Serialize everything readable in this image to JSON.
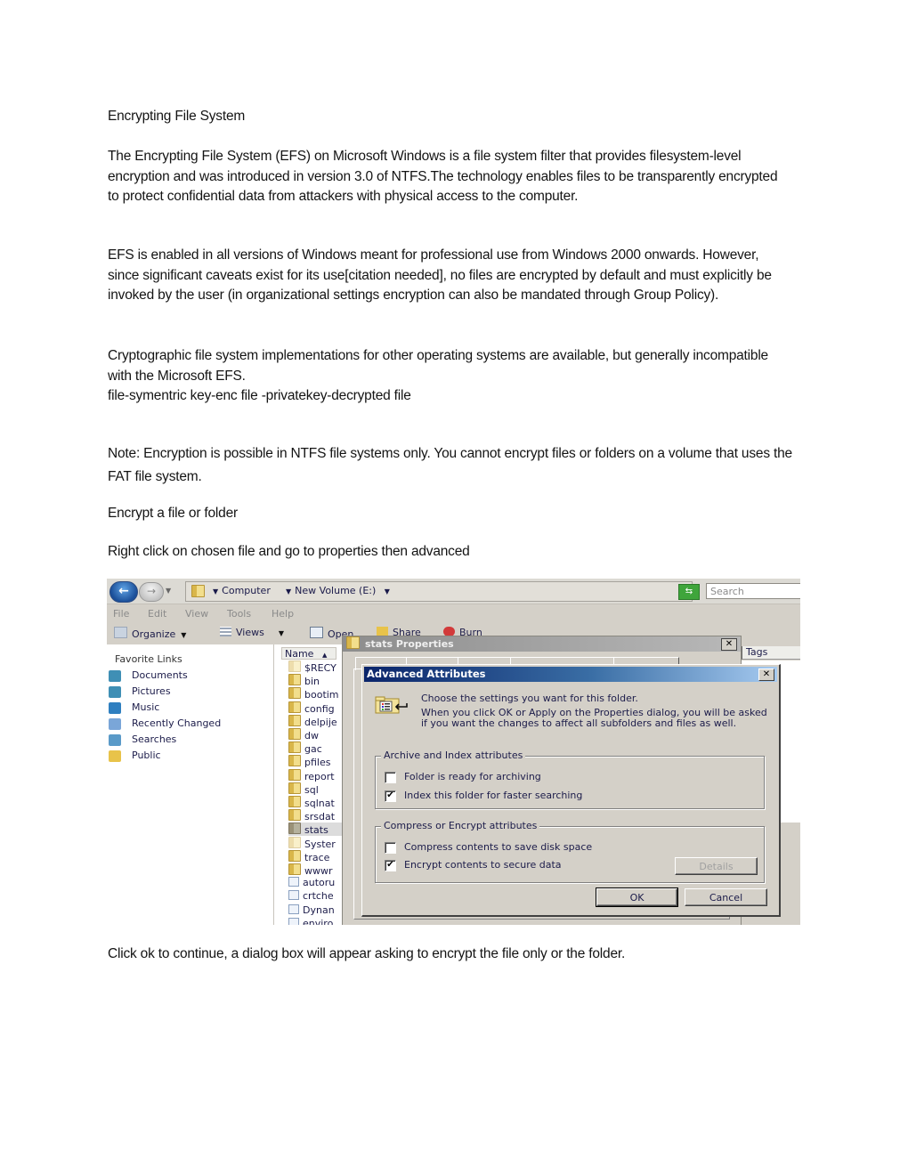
{
  "document": {
    "title": "Encrypting File System",
    "paragraphs": {
      "intro": "The Encrypting File System (EFS) on Microsoft Windows is a file system filter that provides filesystem-level encryption and was introduced in version 3.0 of NTFS.The technology enables files to be transparently encrypted to protect confidential data from attackers with physical access to the computer.",
      "enabled": "EFS is enabled in all versions of Windows meant for professional use from Windows 2000 onwards. However, since significant caveats exist for its use[citation needed], no files are encrypted by default and must explicitly be invoked by the user (in organizational settings encryption can also be mandated through Group Policy).",
      "crypto": "Cryptographic file system implementations for other operating systems are available, but generally incompatible with the Microsoft EFS.",
      "flow": "file-symentric key-enc file -privatekey-decrypted file",
      "note": "Note: Encryption is possible in NTFS file systems only. You cannot encrypt files or folders on a volume that uses the FAT file system.",
      "heading2": "Encrypt a file or folder",
      "step1": "Right click on chosen file and go to properties then advanced",
      "step2": "Click ok to continue, a dialog box will appear asking  to encrypt the file only or the folder."
    }
  },
  "screenshot": {
    "address_bar": {
      "breadcrumbs": [
        "Computer",
        "New Volume (E:)"
      ],
      "search_placeholder": "Search",
      "back_icon": "back-arrow-icon",
      "forward_icon": "forward-arrow-icon",
      "refresh_icon": "refresh-icon"
    },
    "menu": [
      "File",
      "Edit",
      "View",
      "Tools",
      "Help"
    ],
    "toolbar": {
      "organize": "Organize",
      "views": "Views",
      "open": "Open",
      "share": "Share",
      "burn": "Burn"
    },
    "favorites": {
      "title": "Favorite Links",
      "items": [
        {
          "label": "Documents",
          "icon": "documents-icon",
          "color": "#3f8fb5"
        },
        {
          "label": "Pictures",
          "icon": "pictures-icon",
          "color": "#3f8fb5"
        },
        {
          "label": "Music",
          "icon": "music-icon",
          "color": "#2f7fc0"
        },
        {
          "label": "Recently Changed",
          "icon": "recent-icon",
          "color": "#7aa6d8"
        },
        {
          "label": "Searches",
          "icon": "searches-icon",
          "color": "#5a9ac8"
        },
        {
          "label": "Public",
          "icon": "folder-icon",
          "color": "#e8c34a"
        }
      ]
    },
    "file_list": {
      "column_name": "Name",
      "column_tags": "Tags",
      "items": [
        "$RECY",
        "bin",
        "bootim",
        "config",
        "delpije",
        "dw",
        "gac",
        "pfiles",
        "report",
        "sql",
        "sqlnat",
        "srsdat",
        "stats",
        "Syster",
        "trace",
        "wwwr",
        "autoru",
        "crtche",
        "Dynan",
        "enviro"
      ],
      "selected": "stats"
    },
    "properties_dialog": {
      "title": "stats Properties"
    },
    "advanced_dialog": {
      "title": "Advanced Attributes",
      "message": "Choose the settings you want for this folder.",
      "detail": "When you click OK or Apply on the Properties dialog, you will be asked if you want the changes to affect all subfolders and files as well.",
      "group1": {
        "label": "Archive and Index attributes",
        "options": [
          {
            "label": "Folder is ready for archiving",
            "checked": false
          },
          {
            "label": "Index this folder for faster searching",
            "checked": true
          }
        ]
      },
      "group2": {
        "label": "Compress or Encrypt attributes",
        "options": [
          {
            "label": "Compress contents to save disk space",
            "checked": false
          },
          {
            "label": "Encrypt contents to secure data",
            "checked": true
          }
        ]
      },
      "details_button": "Details",
      "ok_button": "OK",
      "cancel_button": "Cancel"
    }
  }
}
